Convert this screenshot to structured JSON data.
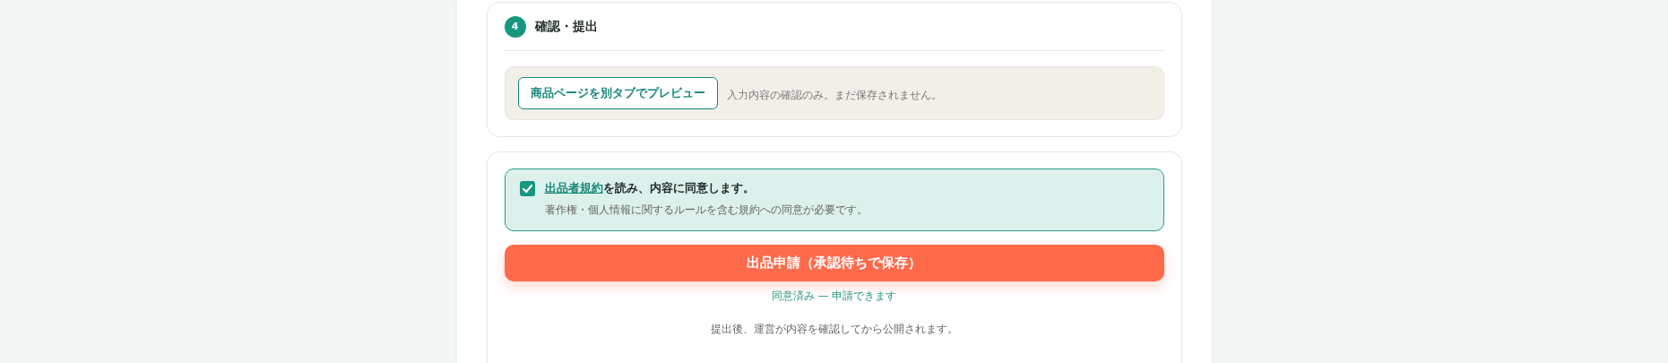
{
  "review_section": {
    "step": "4",
    "title": "確認・提出",
    "preview_button": "商品ページを別タブでプレビュー",
    "preview_note": "入力内容の確認のみ。まだ保存されません。"
  },
  "submit_section": {
    "agreement": {
      "checked": true,
      "link": "出品者規約",
      "text": "を読み、内容に同意します。",
      "note": "著作権・個人情報に関するルールを含む規約への同意が必要です。"
    },
    "submit_button": "出品申請（承認待ちで保存）",
    "status": "同意済み — 申請できます",
    "footer_note": "提出後、運営が内容を確認してから公開されます。"
  }
}
